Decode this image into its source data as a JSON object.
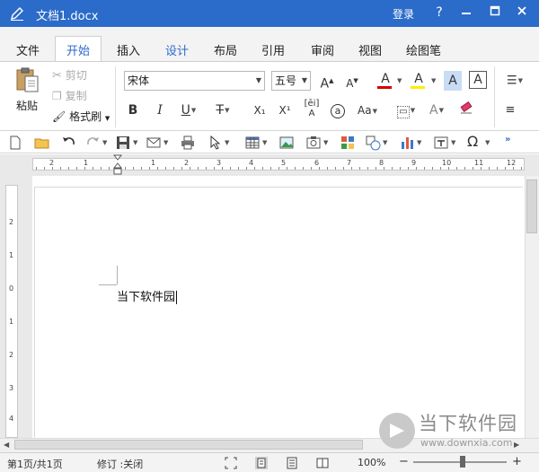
{
  "titlebar": {
    "doc_title": "文档1.docx",
    "login_label": "登录",
    "help_label": "?",
    "colors": {
      "background": "#2b6bc9",
      "text": "#ffffff"
    }
  },
  "tabs": [
    {
      "label": "文件"
    },
    {
      "label": "开始",
      "active": true
    },
    {
      "label": "插入"
    },
    {
      "label": "设计"
    },
    {
      "label": "布局"
    },
    {
      "label": "引用"
    },
    {
      "label": "审阅"
    },
    {
      "label": "视图"
    },
    {
      "label": "绘图笔"
    }
  ],
  "clipboard": {
    "paste_label": "粘贴",
    "cut_label": "剪切",
    "copy_label": "复制",
    "format_painter_label": "格式刷"
  },
  "font": {
    "font_name": "宋体",
    "font_size": "五号",
    "grow_glyph": "A",
    "shrink_glyph": "A",
    "color_glyph": "A",
    "highlight_glyph": "A",
    "shade_glyph": "A",
    "border_glyph": "A",
    "bold_glyph": "B",
    "italic_glyph": "I",
    "underline_glyph": "U",
    "strike_glyph": "T",
    "subscript_glyph": "X₁",
    "superscript_glyph": "X¹",
    "circle_glyph": "a",
    "case_glyph": "Aa",
    "effects_glyph": "A",
    "font_color": "#d40000",
    "highlight_color": "#ffee00"
  },
  "ruler": {
    "h_numbers": [
      "2",
      "1",
      "1",
      "2",
      "3",
      "4",
      "5",
      "6",
      "7",
      "8",
      "9",
      "10",
      "11",
      "12"
    ],
    "v_numbers": [
      "2",
      "1",
      "0",
      "1",
      "2",
      "3",
      "4"
    ]
  },
  "document": {
    "text": "当下软件园"
  },
  "status": {
    "page_info": "第1页/共1页",
    "track_changes": "修订 :关闭",
    "zoom_level": "100%",
    "zoom_out": "−",
    "zoom_in": "+"
  },
  "watermark": {
    "title": "当下软件园",
    "url": "www.downxia.com"
  }
}
